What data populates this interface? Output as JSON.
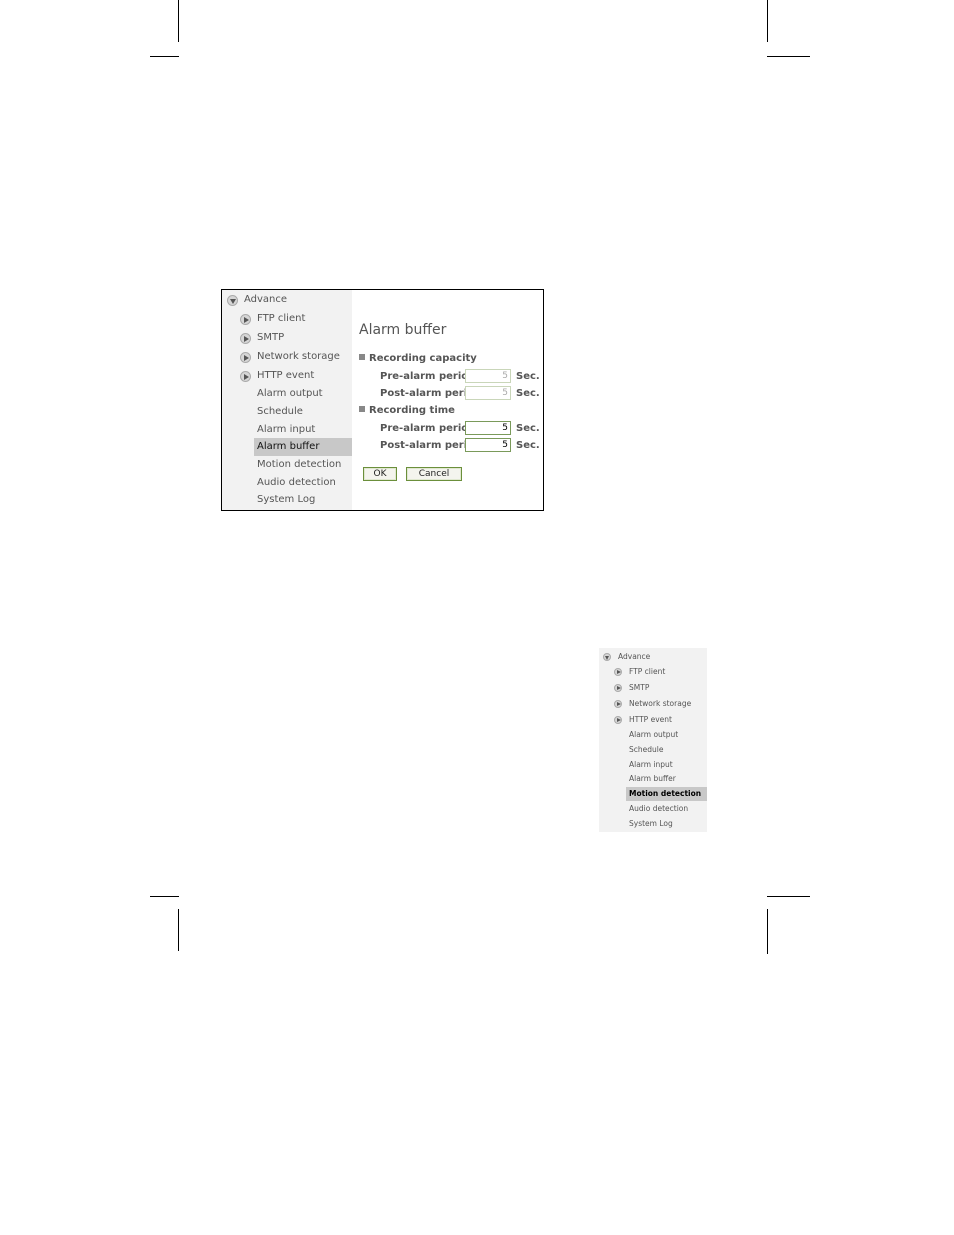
{
  "main": {
    "sidebar": {
      "root": "Advance",
      "items": [
        "FTP client",
        "SMTP",
        "Network storage",
        "HTTP event",
        "Alarm output",
        "Schedule",
        "Alarm input",
        "Alarm buffer",
        "Motion detection",
        "Audio detection",
        "System Log"
      ],
      "selected": "Alarm buffer"
    },
    "title": "Alarm buffer",
    "recording_capacity": {
      "heading": "Recording capacity",
      "pre_label": "Pre-alarm period",
      "pre_value": "5",
      "post_label": "Post-alarm period",
      "post_value": "5",
      "unit": "Sec."
    },
    "recording_time": {
      "heading": "Recording time",
      "pre_label": "Pre-alarm period",
      "pre_value": "5",
      "post_label": "Post-alarm period",
      "post_value": "5",
      "unit": "Sec."
    },
    "buttons": {
      "ok": "OK",
      "cancel": "Cancel"
    }
  },
  "inset": {
    "sidebar": {
      "root": "Advance",
      "items": [
        "FTP client",
        "SMTP",
        "Network storage",
        "HTTP event",
        "Alarm output",
        "Schedule",
        "Alarm input",
        "Alarm buffer",
        "Motion detection",
        "Audio detection",
        "System Log"
      ],
      "selected": "Motion detection"
    }
  },
  "colors": {
    "sidebar_bg": "#f2f2f2",
    "selected_bg": "#c8c8c8",
    "button_border": "#6b8f3b"
  }
}
